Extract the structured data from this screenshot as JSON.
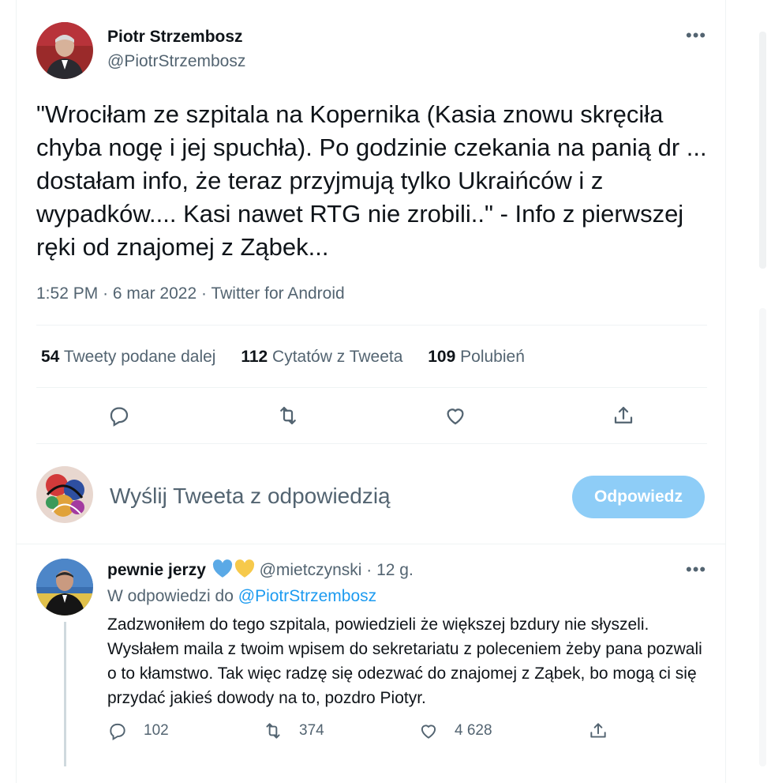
{
  "tweet": {
    "author_name": "Piotr Strzembosz",
    "author_handle": "@PiotrStrzembosz",
    "text": "\"Wrociłam ze szpitala na Kopernika (Kasia znowu skręciła chyba nogę i jej spuchła). Po godzinie czekania na panią dr ... dostałam info, że teraz przyjmują tylko Ukraińców i z wypadków.... Kasi nawet RTG nie zrobili..\" - Info z pierwszej ręki od znajomej z Ząbek...",
    "time": "1:52 PM",
    "date": "6 mar 2022",
    "source": "Twitter for Android",
    "separator": "·"
  },
  "stats": [
    {
      "count": "54",
      "label": "Tweety podane dalej"
    },
    {
      "count": "112",
      "label": "Cytatów z Tweeta"
    },
    {
      "count": "109",
      "label": "Polubień"
    }
  ],
  "actions": {
    "icons": [
      "reply-icon",
      "retweet-icon",
      "like-icon",
      "share-icon"
    ]
  },
  "compose": {
    "placeholder": "Wyślij Tweeta z odpowiedzią",
    "button_label": "Odpowiedz"
  },
  "reply": {
    "author_name": "pewnie jerzy",
    "hearts": [
      "blue-heart-icon",
      "yellow-heart-icon"
    ],
    "author_handle": "@mietczynski",
    "separator": "·",
    "age": "12 g.",
    "replying_prefix": "W odpowiedzi do",
    "replying_to": "@PiotrStrzembosz",
    "text": "Zadzwoniłem do tego szpitala, powiedzieli że większej bzdury nie słyszeli. Wysłałem maila z twoim wpisem do sekretariatu z poleceniem żeby pana pozwali o to kłamstwo. Tak więc radzę się odezwać do znajomej z Ząbek, bo mogą ci się przydać jakieś dowody na to, pozdro Piotyr.",
    "replies": "102",
    "retweets": "374",
    "likes": "4 628"
  },
  "colors": {
    "text": "#0f1419",
    "secondary": "#536471",
    "accent": "#1d9bf0",
    "button_disabled": "#8ecdf7",
    "divider": "#eff3f4",
    "blue_heart": "#5aa9e6",
    "yellow_heart": "#f6c94b"
  }
}
